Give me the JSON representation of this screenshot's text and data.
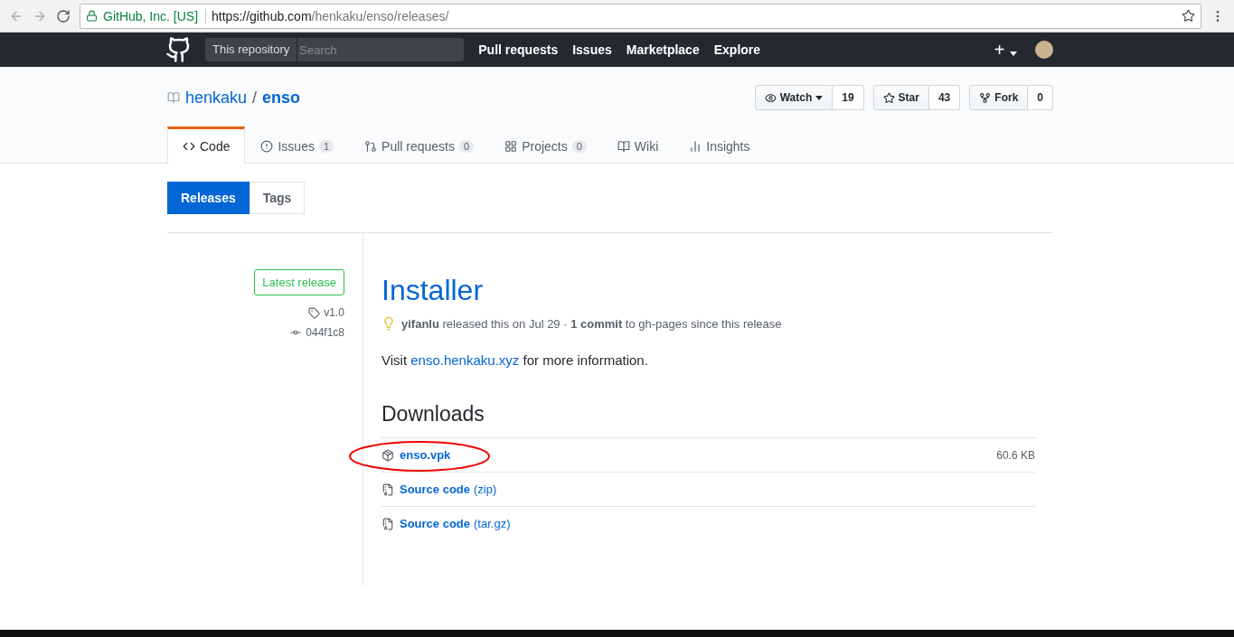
{
  "browser": {
    "security_label": "GitHub, Inc. [US]",
    "url_host": "https://github.com",
    "url_path": "/henkaku/enso/releases/"
  },
  "header": {
    "scope": "This repository",
    "search_placeholder": "Search",
    "nav": [
      "Pull requests",
      "Issues",
      "Marketplace",
      "Explore"
    ],
    "new_label": "+"
  },
  "repo": {
    "owner": "henkaku",
    "separator": "/",
    "name": "enso"
  },
  "actions": [
    {
      "kind": "watch",
      "label": "Watch",
      "count": "19"
    },
    {
      "kind": "star",
      "label": "Star",
      "count": "43"
    },
    {
      "kind": "fork",
      "label": "Fork",
      "count": "0"
    }
  ],
  "tabs": [
    {
      "kind": "code",
      "label": "Code",
      "selected": true
    },
    {
      "kind": "issues",
      "label": "Issues",
      "count": "1",
      "selected": false
    },
    {
      "kind": "pulls",
      "label": "Pull requests",
      "count": "0",
      "selected": false
    },
    {
      "kind": "projects",
      "label": "Projects",
      "count": "0",
      "selected": false
    },
    {
      "kind": "wiki",
      "label": "Wiki",
      "selected": false
    },
    {
      "kind": "insights",
      "label": "Insights",
      "selected": false
    }
  ],
  "subnav": [
    {
      "label": "Releases",
      "selected": true
    },
    {
      "label": "Tags",
      "selected": false
    }
  ],
  "release": {
    "badge": "Latest release",
    "tag": "v1.0",
    "commit": "044f1c8",
    "title": "Installer",
    "meta": "**yifanlu** released this on Jul 29 · **1 commit** to gh-pages since this release",
    "body_before": "Visit ",
    "body_link": "enso.henkaku.xyz",
    "body_after": " for more information.",
    "downloads_title": "Downloads",
    "assets": [
      {
        "kind": "package",
        "name": "enso.vpk",
        "size": "60.6 KB",
        "circled": true
      },
      {
        "kind": "archive",
        "name": "Source code",
        "suffix": "(zip)",
        "circled": false
      },
      {
        "kind": "archive",
        "name": "Source code",
        "suffix": "(tar.gz)",
        "circled": false
      }
    ]
  }
}
